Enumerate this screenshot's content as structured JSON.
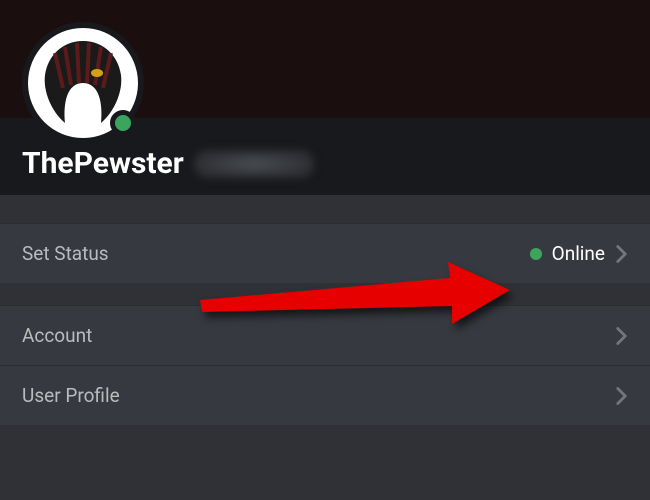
{
  "profile": {
    "username": "ThePewster",
    "presence_color": "#3ba55d"
  },
  "rows": {
    "set_status": {
      "label": "Set Status",
      "value": "Online",
      "dot_color": "#3ba55d"
    },
    "account": {
      "label": "Account"
    },
    "user_profile": {
      "label": "User Profile"
    }
  }
}
